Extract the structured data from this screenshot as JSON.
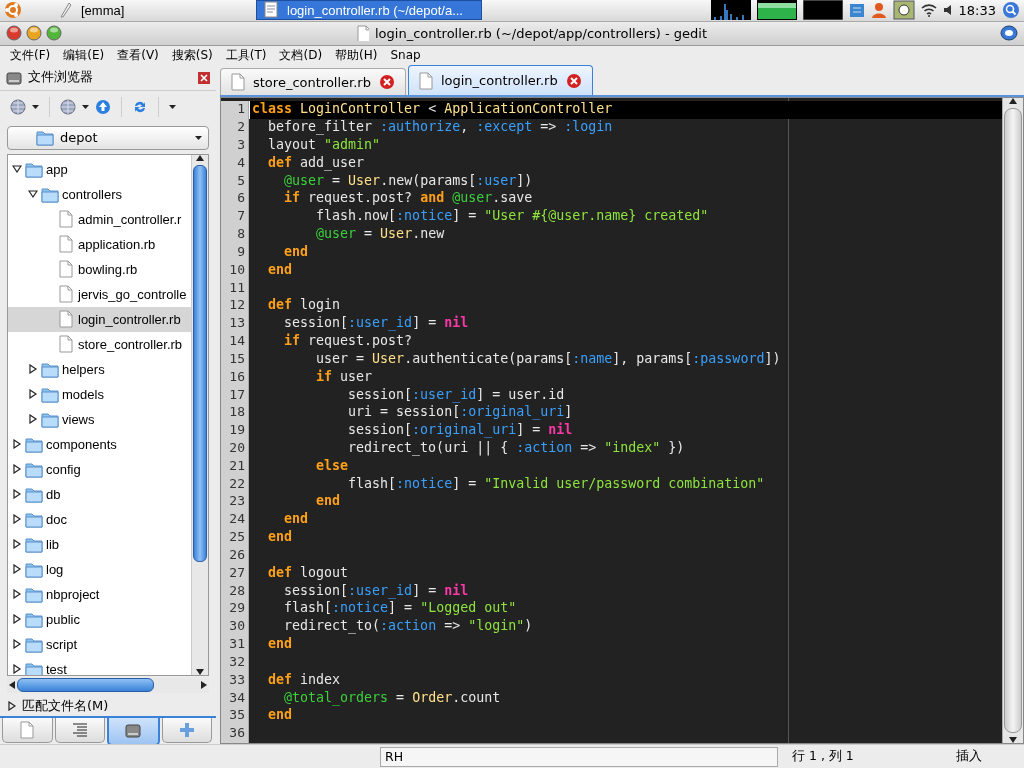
{
  "top_panel": {
    "tasks": [
      {
        "label": "[emma]",
        "selected": false
      },
      {
        "label": "login_controller.rb (~/depot/a...",
        "selected": true
      }
    ],
    "clock": "18:33"
  },
  "window": {
    "title": "login_controller.rb (~/depot/app/controllers) - gedit"
  },
  "menu": [
    "文件(F)",
    "编辑(E)",
    "查看(V)",
    "搜索(S)",
    "工具(T)",
    "文档(D)",
    "帮助(H)",
    "Snap"
  ],
  "file_browser": {
    "title": "文件浏览器",
    "location": "depot",
    "tree": [
      {
        "label": "app",
        "kind": "folder",
        "expanded": true,
        "selected": false,
        "children": [
          {
            "label": "controllers",
            "kind": "folder",
            "expanded": true,
            "selected": false,
            "children": [
              {
                "label": "admin_controller.r",
                "kind": "file",
                "selected": false
              },
              {
                "label": "application.rb",
                "kind": "file",
                "selected": false
              },
              {
                "label": "bowling.rb",
                "kind": "file",
                "selected": false
              },
              {
                "label": "jervis_go_controlle",
                "kind": "file",
                "selected": false
              },
              {
                "label": "login_controller.rb",
                "kind": "file",
                "selected": true
              },
              {
                "label": "store_controller.rb",
                "kind": "file",
                "selected": false
              }
            ]
          },
          {
            "label": "helpers",
            "kind": "folder",
            "expanded": false,
            "selected": false
          },
          {
            "label": "models",
            "kind": "folder",
            "expanded": false,
            "selected": false
          },
          {
            "label": "views",
            "kind": "folder",
            "expanded": false,
            "selected": false
          }
        ]
      },
      {
        "label": "components",
        "kind": "folder",
        "expanded": false,
        "selected": false
      },
      {
        "label": "config",
        "kind": "folder",
        "expanded": false,
        "selected": false
      },
      {
        "label": "db",
        "kind": "folder",
        "expanded": false,
        "selected": false
      },
      {
        "label": "doc",
        "kind": "folder",
        "expanded": false,
        "selected": false
      },
      {
        "label": "lib",
        "kind": "folder",
        "expanded": false,
        "selected": false
      },
      {
        "label": "log",
        "kind": "folder",
        "expanded": false,
        "selected": false
      },
      {
        "label": "nbproject",
        "kind": "folder",
        "expanded": false,
        "selected": false
      },
      {
        "label": "public",
        "kind": "folder",
        "expanded": false,
        "selected": false
      },
      {
        "label": "script",
        "kind": "folder",
        "expanded": false,
        "selected": false
      },
      {
        "label": "test",
        "kind": "folder",
        "expanded": false,
        "selected": false
      }
    ],
    "filter_label": "匹配文件名(M)",
    "side_tabs": [
      {
        "kind": "documents",
        "selected": false
      },
      {
        "kind": "outline",
        "selected": false
      },
      {
        "kind": "files",
        "selected": true
      },
      {
        "kind": "snippets",
        "selected": false
      }
    ]
  },
  "editor": {
    "tabs": [
      {
        "label": "store_controller.rb",
        "selected": false
      },
      {
        "label": "login_controller.rb",
        "selected": true
      }
    ],
    "lines": [
      {
        "number": "1",
        "current": true,
        "tokens": [
          {
            "kind": "keyword",
            "text": "class"
          },
          {
            "kind": "constant",
            "text": " LoginController"
          },
          {
            "kind": "plain",
            "text": " < "
          },
          {
            "kind": "constant",
            "text": "ApplicationController"
          }
        ]
      },
      {
        "number": "2",
        "current": false,
        "tokens": [
          {
            "kind": "plain",
            "text": "  before_filter "
          },
          {
            "kind": "symbol",
            "text": ":authorize"
          },
          {
            "kind": "plain",
            "text": ", "
          },
          {
            "kind": "symbol",
            "text": ":except"
          },
          {
            "kind": "plain",
            "text": " => "
          },
          {
            "kind": "symbol",
            "text": ":login"
          }
        ]
      },
      {
        "number": "3",
        "current": false,
        "tokens": [
          {
            "kind": "plain",
            "text": "  layout "
          },
          {
            "kind": "string",
            "text": "\"admin\""
          }
        ]
      },
      {
        "number": "4",
        "current": false,
        "tokens": [
          {
            "kind": "keyword",
            "text": "  def"
          },
          {
            "kind": "plain",
            "text": " add_user"
          }
        ]
      },
      {
        "number": "5",
        "current": false,
        "tokens": [
          {
            "kind": "ivar",
            "text": "    @user"
          },
          {
            "kind": "plain",
            "text": " = "
          },
          {
            "kind": "constant",
            "text": "User"
          },
          {
            "kind": "plain",
            "text": ".new(params["
          },
          {
            "kind": "symbol",
            "text": ":user"
          },
          {
            "kind": "plain",
            "text": "])"
          }
        ]
      },
      {
        "number": "6",
        "current": false,
        "tokens": [
          {
            "kind": "keyword",
            "text": "    if"
          },
          {
            "kind": "plain",
            "text": " request.post? "
          },
          {
            "kind": "keyword",
            "text": "and"
          },
          {
            "kind": "ivar",
            "text": " @user"
          },
          {
            "kind": "plain",
            "text": ".save"
          }
        ]
      },
      {
        "number": "7",
        "current": false,
        "tokens": [
          {
            "kind": "plain",
            "text": "        flash.now["
          },
          {
            "kind": "symbol",
            "text": ":notice"
          },
          {
            "kind": "plain",
            "text": "] = "
          },
          {
            "kind": "string",
            "text": "\"User #{@user.name} created\""
          }
        ]
      },
      {
        "number": "8",
        "current": false,
        "tokens": [
          {
            "kind": "ivar",
            "text": "        @user"
          },
          {
            "kind": "plain",
            "text": " = "
          },
          {
            "kind": "constant",
            "text": "User"
          },
          {
            "kind": "plain",
            "text": ".new"
          }
        ]
      },
      {
        "number": "9",
        "current": false,
        "tokens": [
          {
            "kind": "keyword",
            "text": "    end"
          }
        ]
      },
      {
        "number": "10",
        "current": false,
        "tokens": [
          {
            "kind": "keyword",
            "text": "  end"
          }
        ]
      },
      {
        "number": "11",
        "current": false
      },
      {
        "number": "12",
        "current": false,
        "tokens": [
          {
            "kind": "keyword",
            "text": "  def"
          },
          {
            "kind": "plain",
            "text": " login"
          }
        ]
      },
      {
        "number": "13",
        "current": false,
        "tokens": [
          {
            "kind": "plain",
            "text": "    session["
          },
          {
            "kind": "symbol",
            "text": ":user_id"
          },
          {
            "kind": "plain",
            "text": "] = "
          },
          {
            "kind": "nil",
            "text": "nil"
          }
        ]
      },
      {
        "number": "14",
        "current": false,
        "tokens": [
          {
            "kind": "keyword",
            "text": "    if"
          },
          {
            "kind": "plain",
            "text": " request.post?"
          }
        ]
      },
      {
        "number": "15",
        "current": false,
        "tokens": [
          {
            "kind": "plain",
            "text": "        user = "
          },
          {
            "kind": "constant",
            "text": "User"
          },
          {
            "kind": "plain",
            "text": ".authenticate(params["
          },
          {
            "kind": "symbol",
            "text": ":name"
          },
          {
            "kind": "plain",
            "text": "], params["
          },
          {
            "kind": "symbol",
            "text": ":password"
          },
          {
            "kind": "plain",
            "text": "])"
          }
        ]
      },
      {
        "number": "16",
        "current": false,
        "tokens": [
          {
            "kind": "keyword",
            "text": "        if"
          },
          {
            "kind": "plain",
            "text": " user"
          }
        ]
      },
      {
        "number": "17",
        "current": false,
        "tokens": [
          {
            "kind": "plain",
            "text": "            session["
          },
          {
            "kind": "symbol",
            "text": ":user_id"
          },
          {
            "kind": "plain",
            "text": "] = user.id"
          }
        ]
      },
      {
        "number": "18",
        "current": false,
        "tokens": [
          {
            "kind": "plain",
            "text": "            uri = session["
          },
          {
            "kind": "symbol",
            "text": ":original_uri"
          },
          {
            "kind": "plain",
            "text": "]"
          }
        ]
      },
      {
        "number": "19",
        "current": false,
        "tokens": [
          {
            "kind": "plain",
            "text": "            session["
          },
          {
            "kind": "symbol",
            "text": ":original_uri"
          },
          {
            "kind": "plain",
            "text": "] = "
          },
          {
            "kind": "nil",
            "text": "nil"
          }
        ]
      },
      {
        "number": "20",
        "current": false,
        "tokens": [
          {
            "kind": "plain",
            "text": "            redirect_to(uri || { "
          },
          {
            "kind": "symbol",
            "text": ":action"
          },
          {
            "kind": "plain",
            "text": " => "
          },
          {
            "kind": "string",
            "text": "\"index\""
          },
          {
            "kind": "plain",
            "text": " })"
          }
        ]
      },
      {
        "number": "21",
        "current": false,
        "tokens": [
          {
            "kind": "keyword",
            "text": "        else"
          }
        ]
      },
      {
        "number": "22",
        "current": false,
        "tokens": [
          {
            "kind": "plain",
            "text": "            flash["
          },
          {
            "kind": "symbol",
            "text": ":notice"
          },
          {
            "kind": "plain",
            "text": "] = "
          },
          {
            "kind": "string",
            "text": "\"Invalid user/password combination\""
          }
        ]
      },
      {
        "number": "23",
        "current": false,
        "tokens": [
          {
            "kind": "keyword",
            "text": "        end"
          }
        ]
      },
      {
        "number": "24",
        "current": false,
        "tokens": [
          {
            "kind": "keyword",
            "text": "    end"
          }
        ]
      },
      {
        "number": "25",
        "current": false,
        "tokens": [
          {
            "kind": "keyword",
            "text": "  end"
          }
        ]
      },
      {
        "number": "26",
        "current": false
      },
      {
        "number": "27",
        "current": false,
        "tokens": [
          {
            "kind": "keyword",
            "text": "  def"
          },
          {
            "kind": "plain",
            "text": " logout"
          }
        ]
      },
      {
        "number": "28",
        "current": false,
        "tokens": [
          {
            "kind": "plain",
            "text": "    session["
          },
          {
            "kind": "symbol",
            "text": ":user_id"
          },
          {
            "kind": "plain",
            "text": "] = "
          },
          {
            "kind": "nil",
            "text": "nil"
          }
        ]
      },
      {
        "number": "29",
        "current": false,
        "tokens": [
          {
            "kind": "plain",
            "text": "    flash["
          },
          {
            "kind": "symbol",
            "text": ":notice"
          },
          {
            "kind": "plain",
            "text": "] = "
          },
          {
            "kind": "string",
            "text": "\"Logged out\""
          }
        ]
      },
      {
        "number": "30",
        "current": false,
        "tokens": [
          {
            "kind": "plain",
            "text": "    redirect_to("
          },
          {
            "kind": "symbol",
            "text": ":action"
          },
          {
            "kind": "plain",
            "text": " => "
          },
          {
            "kind": "string",
            "text": "\"login\""
          },
          {
            "kind": "plain",
            "text": ")"
          }
        ]
      },
      {
        "number": "31",
        "current": false,
        "tokens": [
          {
            "kind": "keyword",
            "text": "  end"
          }
        ]
      },
      {
        "number": "32",
        "current": false
      },
      {
        "number": "33",
        "current": false,
        "tokens": [
          {
            "kind": "keyword",
            "text": "  def"
          },
          {
            "kind": "plain",
            "text": " index"
          }
        ]
      },
      {
        "number": "34",
        "current": false,
        "tokens": [
          {
            "kind": "ivar",
            "text": "    @total_orders"
          },
          {
            "kind": "plain",
            "text": " = "
          },
          {
            "kind": "constant",
            "text": "Order"
          },
          {
            "kind": "plain",
            "text": ".count"
          }
        ]
      },
      {
        "number": "35",
        "current": false,
        "tokens": [
          {
            "kind": "keyword",
            "text": "  end"
          }
        ]
      },
      {
        "number": "36",
        "current": false
      }
    ]
  },
  "status_bar": {
    "mode": "RH",
    "position": "行 1 , 列 1",
    "insert_mode": "插入"
  }
}
